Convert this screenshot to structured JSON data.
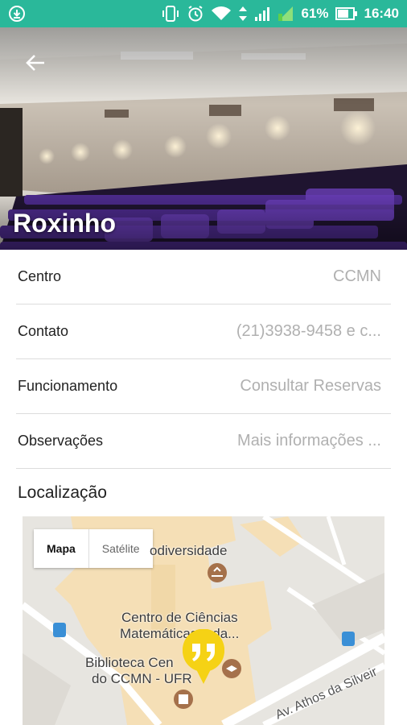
{
  "status_bar": {
    "battery": "61%",
    "time": "16:40",
    "icons": [
      "download-icon",
      "vibrate-icon",
      "alarm-icon",
      "wifi-icon",
      "data-arrows-icon",
      "signal-icon",
      "signal-icon",
      "battery-icon"
    ]
  },
  "header": {
    "title": "Roxinho",
    "back_icon": "arrow-left-icon"
  },
  "details": [
    {
      "label": "Centro",
      "value": "CCMN"
    },
    {
      "label": "Contato",
      "value": "(21)3938-9458 e c..."
    },
    {
      "label": "Funcionamento",
      "value": "Consultar Reservas"
    },
    {
      "label": "Observações",
      "value": "Mais informações ..."
    }
  ],
  "location": {
    "title": "Localização",
    "map_toggle": {
      "map": "Mapa",
      "satellite": "Satélite"
    },
    "labels": {
      "biodiversidade": "odiversidade",
      "centro_line1": "Centro de Ciências",
      "centro_line2": "Matemáticas e da...",
      "biblioteca_line1": "Biblioteca Cen",
      "biblioteca_line2": "do CCMN - UFR",
      "road": "Av. Athos da Silveir"
    },
    "colors": {
      "pin": "#f5d215",
      "accent": "#2ab89a"
    }
  }
}
